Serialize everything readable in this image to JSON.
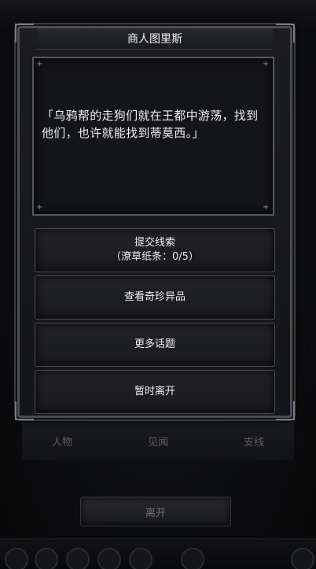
{
  "background": {
    "tabs": [
      "人物",
      "见闻",
      "支线"
    ],
    "leave_button": "离开"
  },
  "dialog": {
    "title": "商人图里斯",
    "text": "「乌鸦帮的走狗们就在王都中游荡，找到他们，也许就能找到蒂莫西。」",
    "options": [
      {
        "label": "提交线索",
        "sub": "（潦草纸条：0/5）"
      },
      {
        "label": "查看奇珍异品"
      },
      {
        "label": "更多话题"
      },
      {
        "label": "暂时离开"
      }
    ]
  },
  "colors": {
    "frame": "#4a4c52",
    "panel_bg": "#141518",
    "text": "#efefef"
  }
}
